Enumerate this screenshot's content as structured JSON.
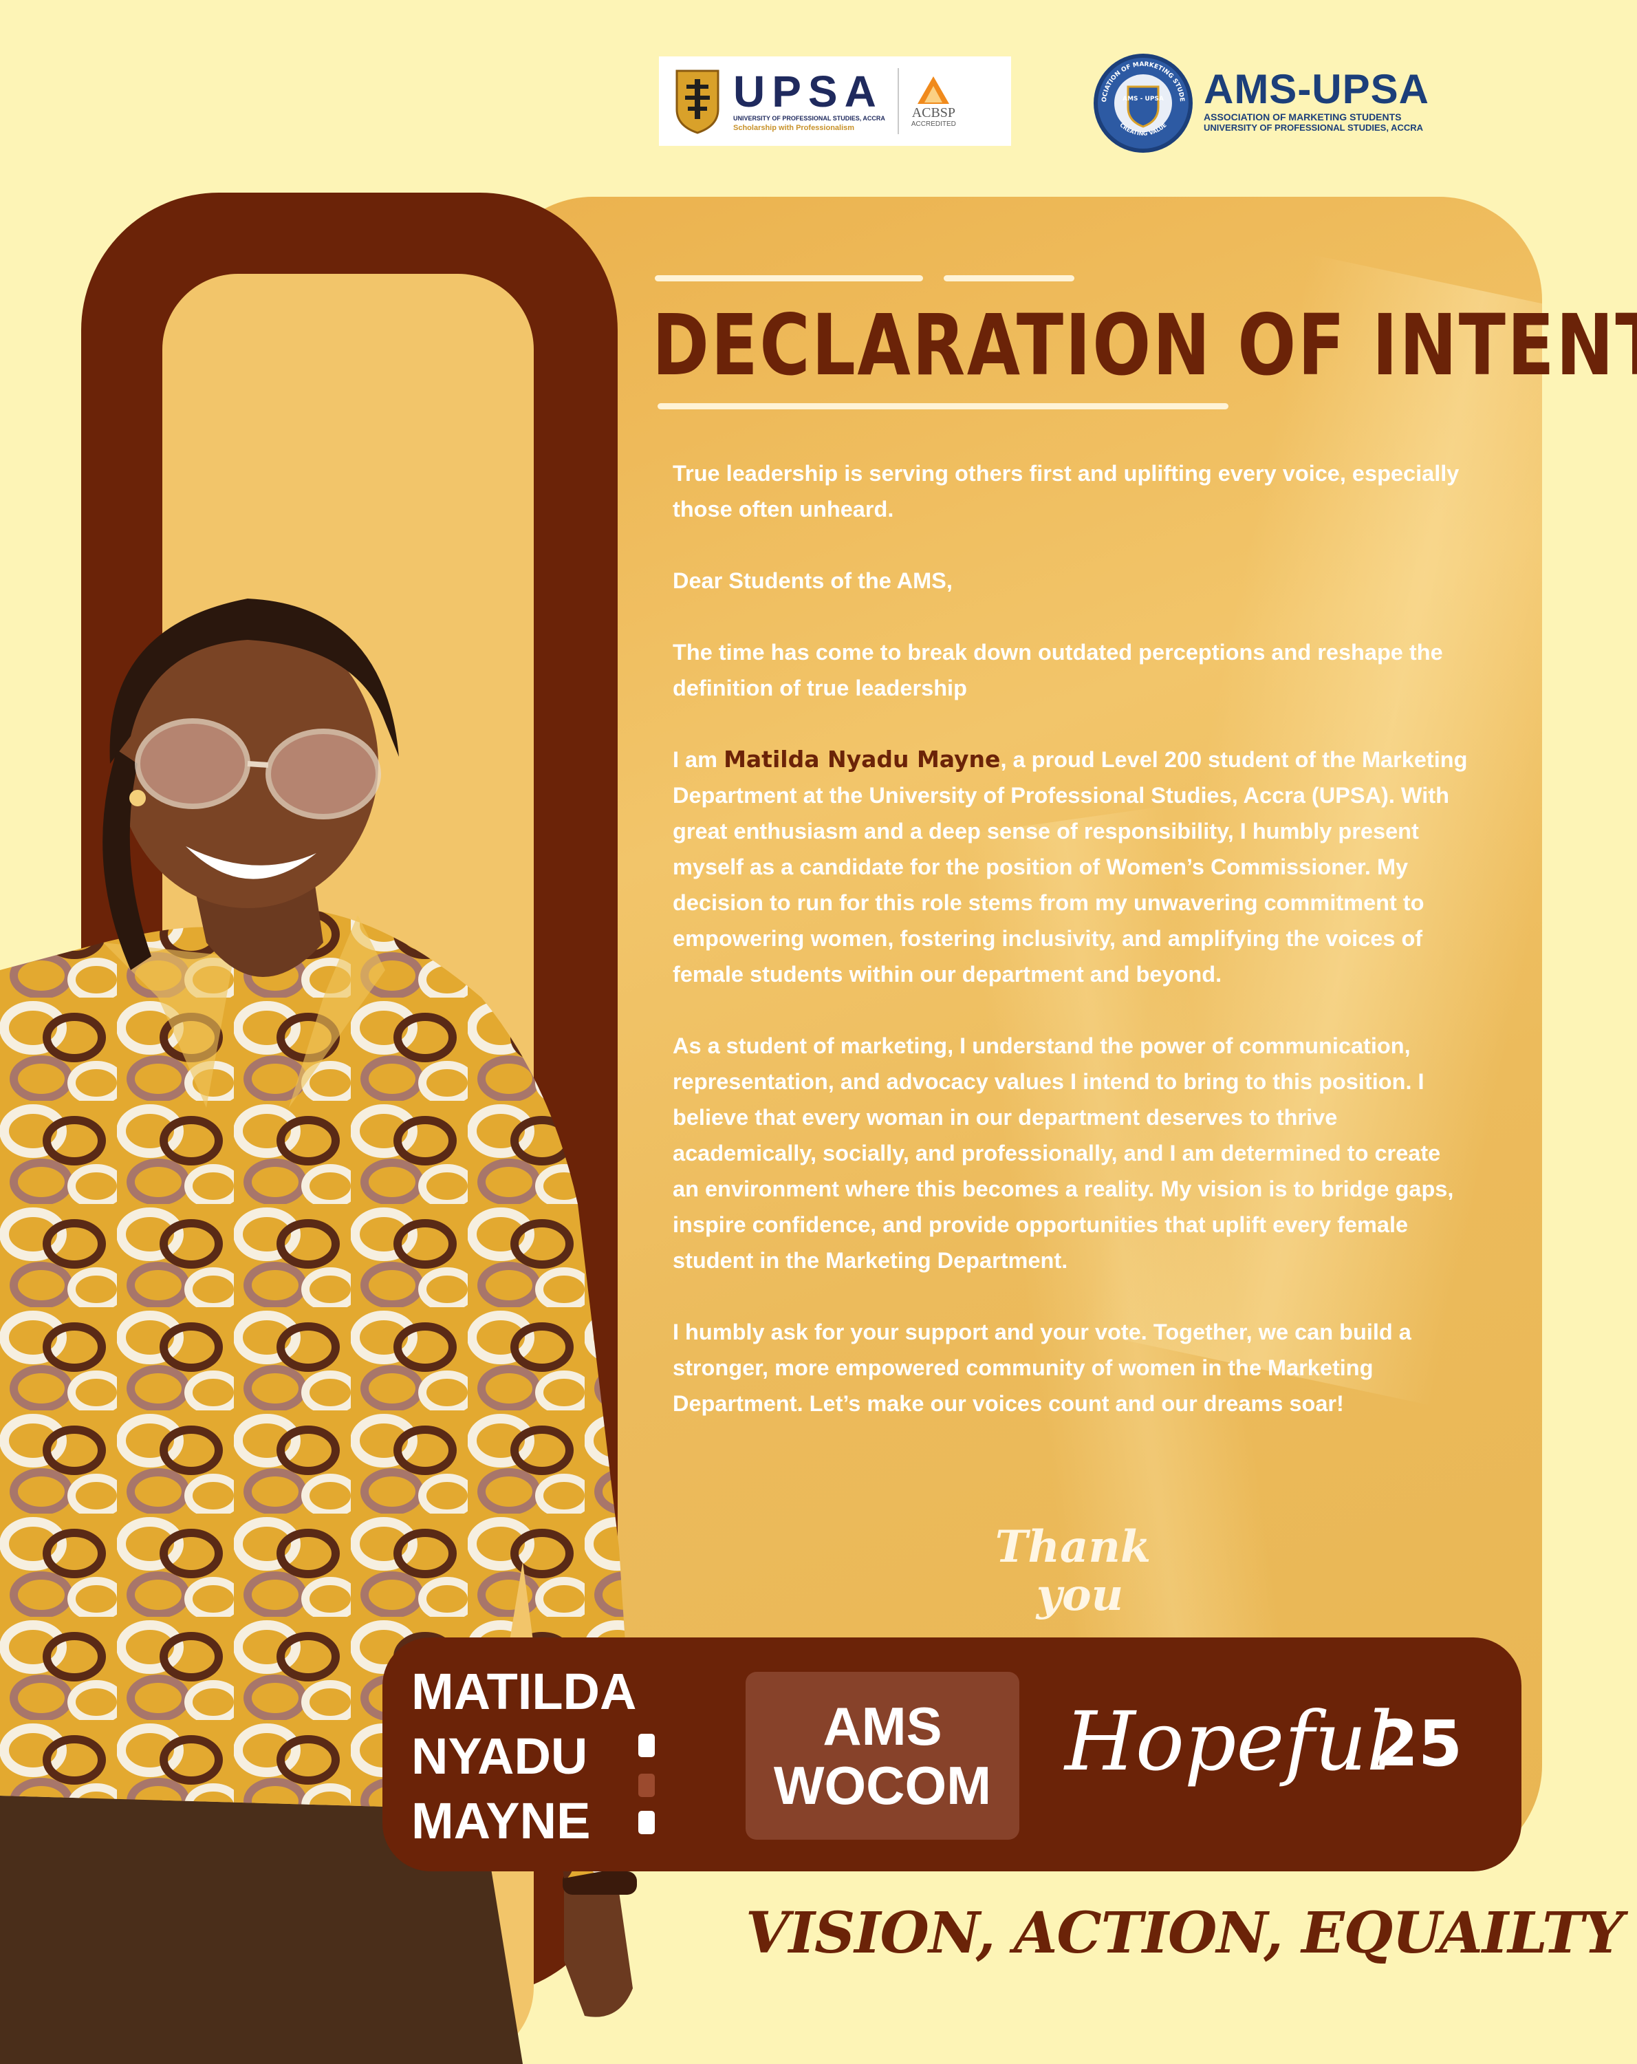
{
  "header": {
    "upsa_logo": {
      "name": "UPSA",
      "full_name": "UNIVERSITY OF PROFESSIONAL STUDIES, ACCRA",
      "motto": "Scholarship with Professionalism",
      "accreditor": "ACBSP",
      "accreditation": "ACCREDITED"
    },
    "ams_logo": {
      "title": "AMS-UPSA",
      "subtitle": "ASSOCIATION OF MARKETING STUDENTS",
      "university": "UNIVERSITY OF PROFESSIONAL STUDIES, ACCRA",
      "seal_text": "ASSOCIATION OF MARKETING STUDENTS",
      "seal_center": "AMS - UPSA",
      "seal_bottom": "CREATING VALUE"
    }
  },
  "main": {
    "title": "DECLARATION OF INTENT",
    "letter": {
      "quote": "True leadership is serving others first and uplifting every voice, especially those often unheard.",
      "greeting": "Dear Students of the AMS,",
      "intro": "The time has come to break down outdated perceptions and reshape the definition of true leadership",
      "para1_start": "I am ",
      "para1_name": "Matilda Nyadu Mayne",
      "para1_rest": ", a proud Level 200 student of the Marketing Department at the University of Professional Studies, Accra (UPSA). With great enthusiasm and a deep sense of responsibility, I humbly present myself as a candidate for the position of Women’s Commissioner. My decision to run for this role stems from my unwavering commitment to empowering women, fostering inclusivity, and amplifying the voices of female students within our department and beyond.",
      "para2": "As a student of marketing, I understand the power of communication, representation, and advocacy values I intend to bring to this position. I believe that every woman in our department deserves to thrive academically, socially, and professionally, and I am determined to create an environment where this becomes a reality. My vision is to bridge gaps, inspire confidence, and provide opportunities that uplift every female student in the Marketing Department.",
      "para3": "I humbly ask for your support and your vote. Together, we can build a stronger, more empowered community of women in the Marketing Department. Let’s make our voices count and our dreams soar!"
    },
    "thank_you": {
      "line1": "Thank",
      "line2": "you"
    }
  },
  "candidate": {
    "name_lines": [
      "MATILDA",
      "NYADU",
      "MAYNE"
    ],
    "position_lines": [
      "AMS",
      "WOCOM"
    ],
    "hopeful": "Hopeful",
    "year": "25"
  },
  "slogan": "VISION, ACTION, EQUAILTY",
  "colors": {
    "background": "#fdf4b6",
    "brown": "#6b2308",
    "gold": "#f2c56a",
    "position_box": "#87422a",
    "upsa_navy": "#1f2a5e",
    "ams_blue": "#1c3f7a"
  }
}
